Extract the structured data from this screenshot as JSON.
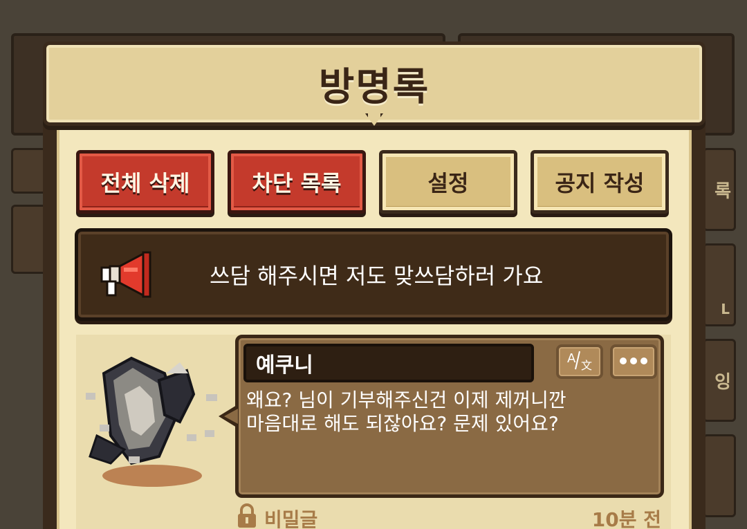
{
  "dialog": {
    "title": "방명록"
  },
  "toolbar": {
    "delete_all": "전체 삭제",
    "block_list": "차단 목록",
    "settings": "설정",
    "write_notice": "공지 작성"
  },
  "notice": {
    "text": "쓰담 해주시면 저도 맞쓰담하러 가요"
  },
  "entry": {
    "author": "예쿠니",
    "message_lines": [
      "왜요? 님이 기부해주신건 이제 제꺼니깐",
      "마음대로 해도 되잖아요? 문제 있어요?"
    ],
    "translate_icon": "translate-icon",
    "more_icon": "more-dots-icon",
    "secret_label": "비밀글",
    "time": "10분 전"
  },
  "background": {
    "tab_labels": [
      "록",
      "L",
      "잉"
    ]
  },
  "colors": {
    "red_button": "#c43a2c",
    "tan_button": "#d9bf7f",
    "notice_bg": "#3f2b18",
    "bubble_bg": "#8a6a44",
    "meta_text": "#a77b48"
  }
}
